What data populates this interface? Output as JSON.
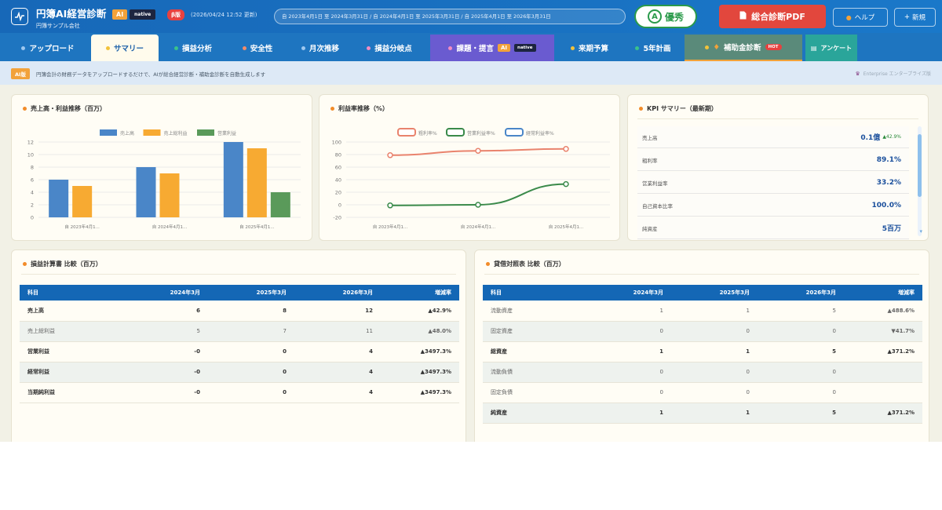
{
  "header": {
    "title": "円簿AI経営診断",
    "company": "円簿サンプル会社",
    "ai_badge": "AI",
    "native_badge": "native",
    "beta_badge": "β版",
    "updated": "(2026/04/24 12:52 更新)",
    "periods": "自 2023年4月1日 至 2024年3月31日 / 自 2024年4月1日 至 2025年3月31日 / 自 2025年4月1日 至 2026年3月31日",
    "grade_letter": "A",
    "grade_text": "優秀",
    "pdf_label": "総合診断PDF",
    "help_label": "ヘルプ",
    "new_label": "新規"
  },
  "tabs": [
    {
      "label": "アップロード",
      "dot": "#9ec8ef"
    },
    {
      "label": "サマリー",
      "dot": "#f2c23a"
    },
    {
      "label": "損益分析",
      "dot": "#3ac28a"
    },
    {
      "label": "安全性",
      "dot": "#f28c6a"
    },
    {
      "label": "月次推移",
      "dot": "#9ec8ef"
    },
    {
      "label": "損益分岐点",
      "dot": "#f28cc2"
    },
    {
      "label": "課題・提言",
      "dot": "#f28cc2",
      "ai": "AI",
      "native": "native"
    },
    {
      "label": "来期予算",
      "dot": "#f2c23a"
    },
    {
      "label": "5年計画",
      "dot": "#3ac28a"
    },
    {
      "label": "補助金診断",
      "dot": "#f2c23a",
      "hot": "HOT"
    },
    {
      "label": "アンケート",
      "icon": "▤"
    }
  ],
  "info": {
    "badge": "AI版",
    "text": "円簿会計の財務データをアップロードするだけで、AIが総合経営診断・補助金診断を自動生成します",
    "right": "Enterprise エンタープライズ版"
  },
  "chart1": {
    "title": "売上高・利益推移（百万）",
    "chart_data": {
      "type": "bar",
      "categories": [
        "自 2023年4月1...",
        "自 2024年4月1...",
        "自 2025年4月1..."
      ],
      "series": [
        {
          "name": "売上高",
          "values": [
            6,
            8,
            12
          ],
          "color": "#4a86c8"
        },
        {
          "name": "売上総利益",
          "values": [
            5,
            7,
            11
          ],
          "color": "#f7aa32"
        },
        {
          "name": "営業利益",
          "values": [
            0,
            0,
            4
          ],
          "color": "#5a9a5a"
        }
      ],
      "yticks": [
        0,
        2,
        4,
        6,
        8,
        10,
        12
      ],
      "ylim": [
        0,
        12
      ],
      "legend": "top-center"
    }
  },
  "chart2": {
    "title": "利益率推移（%）",
    "chart_data": {
      "type": "line",
      "categories": [
        "自 2023年4月1...",
        "自 2024年4月1...",
        "自 2025年4月1..."
      ],
      "series": [
        {
          "name": "粗利率%",
          "values": [
            79,
            86,
            89
          ],
          "color": "#e9836d"
        },
        {
          "name": "営業利益率%",
          "values": [
            -1,
            0,
            33
          ],
          "color": "#3a8a4a"
        },
        {
          "name": "経常利益率%",
          "values": [
            null,
            null,
            null
          ],
          "color": "#4a86c8"
        }
      ],
      "yticks": [
        -20,
        0,
        20,
        40,
        60,
        80,
        100
      ],
      "ylim": [
        -20,
        100
      ],
      "legend": "top-center"
    }
  },
  "kpi": {
    "title": "KPI サマリー（最新期）",
    "items": [
      {
        "label": "売上高",
        "value": "0.1億",
        "change": "▲42.9%"
      },
      {
        "label": "粗利率",
        "value": "89.1%",
        "change": ""
      },
      {
        "label": "営業利益率",
        "value": "33.2%",
        "change": ""
      },
      {
        "label": "自己資本比率",
        "value": "100.0%",
        "change": ""
      },
      {
        "label": "純資産",
        "value": "5百万",
        "change": ""
      }
    ]
  },
  "pl": {
    "title": "損益計算書 比較（百万）",
    "headers": [
      "科目",
      "2024年3月",
      "2025年3月",
      "2026年3月",
      "増減率"
    ],
    "rows": [
      {
        "cells": [
          "売上高",
          "6",
          "8",
          "12",
          "▲42.9%"
        ],
        "style": "bold",
        "dir": "up"
      },
      {
        "cells": [
          "売上総利益",
          "5",
          "7",
          "11",
          "▲48.0%"
        ],
        "style": "light",
        "dir": "up"
      },
      {
        "cells": [
          "営業利益",
          "-0",
          "0",
          "4",
          "▲3497.3%"
        ],
        "style": "bold",
        "dir": "up"
      },
      {
        "cells": [
          "経常利益",
          "-0",
          "0",
          "4",
          "▲3497.3%"
        ],
        "style": "bold",
        "dir": "up"
      },
      {
        "cells": [
          "当期純利益",
          "-0",
          "0",
          "4",
          "▲3497.3%"
        ],
        "style": "bold",
        "dir": "up"
      }
    ]
  },
  "bs": {
    "title": "貸借対照表 比較（百万）",
    "headers": [
      "科目",
      "2024年3月",
      "2025年3月",
      "2026年3月",
      "増減率"
    ],
    "rows": [
      {
        "cells": [
          "流動資産",
          "1",
          "1",
          "5",
          "▲488.6%"
        ],
        "style": "light",
        "dir": "up"
      },
      {
        "cells": [
          "固定資産",
          "0",
          "0",
          "0",
          "▼41.7%"
        ],
        "style": "light",
        "dir": "down"
      },
      {
        "cells": [
          "総資産",
          "1",
          "1",
          "5",
          "▲371.2%"
        ],
        "style": "bold",
        "dir": "up"
      },
      {
        "cells": [
          "流動負債",
          "0",
          "0",
          "0",
          ""
        ],
        "style": "light",
        "dir": ""
      },
      {
        "cells": [
          "固定負債",
          "0",
          "0",
          "0",
          ""
        ],
        "style": "light",
        "dir": ""
      },
      {
        "cells": [
          "純資産",
          "1",
          "1",
          "5",
          "▲371.2%"
        ],
        "style": "bold",
        "dir": "up"
      }
    ]
  }
}
